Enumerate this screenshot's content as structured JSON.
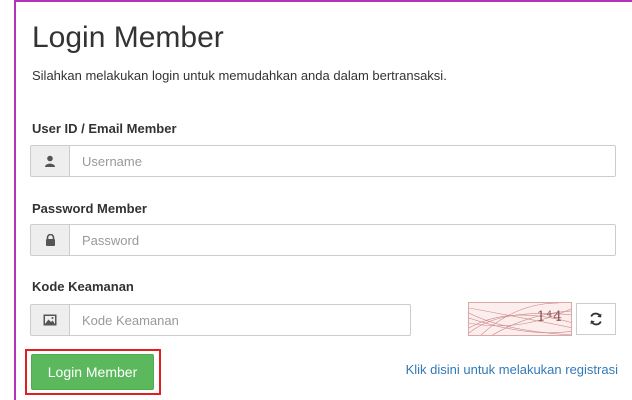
{
  "header": {
    "title": "Login Member",
    "subtitle": "Silahkan melakukan login untuk memudahkan anda dalam bertransaksi."
  },
  "form": {
    "username": {
      "label": "User ID / Email Member",
      "placeholder": "Username",
      "icon": "user-icon"
    },
    "password": {
      "label": "Password Member",
      "placeholder": "Password",
      "icon": "lock-icon"
    },
    "security_code": {
      "label": "Kode Keamanan",
      "placeholder": "Kode Keamanan",
      "icon": "image-icon"
    },
    "captcha_text": "1⁴4",
    "refresh_icon": "refresh-icon"
  },
  "actions": {
    "login_label": "Login Member",
    "register_link": "Klik disini untuk melakukan registrasi"
  },
  "colors": {
    "accent_border": "#b534b5",
    "login_button": "#5cb85c",
    "highlight": "#e02020",
    "link": "#337ab7"
  }
}
